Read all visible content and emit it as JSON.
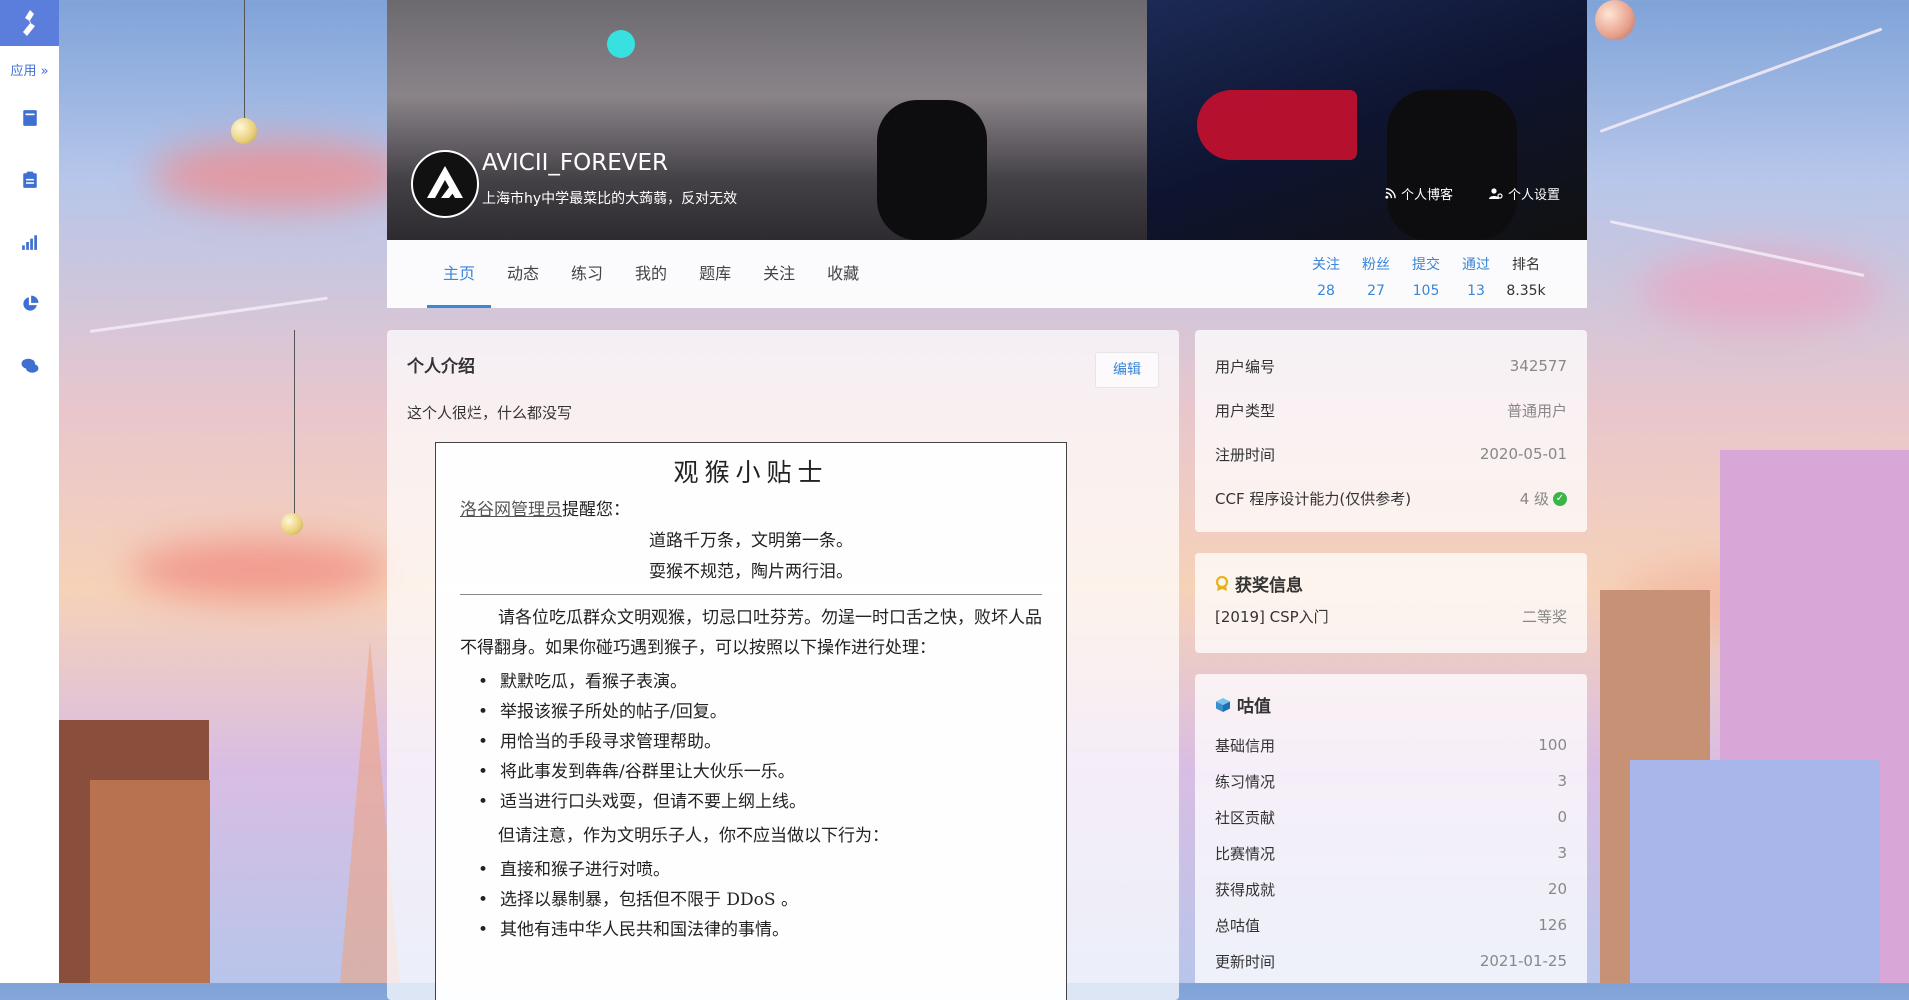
{
  "sidebar": {
    "apps_label": "应用",
    "items": [
      {
        "icon": "book-icon"
      },
      {
        "icon": "clipboard-icon"
      },
      {
        "icon": "signal-bars-icon"
      },
      {
        "icon": "pie-chart-icon"
      },
      {
        "icon": "chat-bubbles-icon"
      }
    ]
  },
  "profile": {
    "username": "AVICII_FOREVER",
    "slogan": "上海市hy中学最菜比的大蒟蒻，反对无效",
    "blog_link": "个人博客",
    "settings_link": "个人设置"
  },
  "nav": {
    "tabs": [
      "主页",
      "动态",
      "练习",
      "我的",
      "题库",
      "关注",
      "收藏"
    ],
    "active_tab": "主页"
  },
  "stats": [
    {
      "label": "关注",
      "value": "28"
    },
    {
      "label": "粉丝",
      "value": "27"
    },
    {
      "label": "提交",
      "value": "105"
    },
    {
      "label": "通过",
      "value": "13"
    },
    {
      "label": "排名",
      "value": "8.35k"
    }
  ],
  "intro": {
    "title": "个人介绍",
    "edit_label": "编辑",
    "text": "这个人很烂，什么都没写",
    "notice": {
      "title": "观猴小贴士",
      "reminder_link": "洛谷网管理员",
      "reminder_rest": "提醒您：",
      "couplet_1": "道路千万条，文明第一条。",
      "couplet_2": "耍猴不规范，陶片两行泪。",
      "paragraph_1": "请各位吃瓜群众文明观猴，切忌口吐芬芳。勿逞一时口舌之快，败坏人品不得翻身。如果你碰巧遇到猴子，可以按照以下操作进行处理：",
      "list_1": [
        "默默吃瓜，看猴子表演。",
        "举报该猴子所处的帖子/回复。",
        "用恰当的手段寻求管理帮助。",
        "将此事发到犇犇/谷群里让大伙乐一乐。",
        "适当进行口头戏耍，但请不要上纲上线。"
      ],
      "paragraph_2": "但请注意，作为文明乐子人，你不应当做以下行为：",
      "list_2": [
        "直接和猴子进行对喷。",
        "选择以暴制暴，包括但不限于 DDoS 。",
        "其他有违中华人民共和国法律的事情。"
      ]
    }
  },
  "user_info": {
    "rows": [
      {
        "label": "用户编号",
        "value": "342577"
      },
      {
        "label": "用户类型",
        "value": "普通用户"
      },
      {
        "label": "注册时间",
        "value": "2020-05-01"
      },
      {
        "label": "CCF 程序设计能力(仅供参考)",
        "value": "4 级"
      }
    ]
  },
  "awards": {
    "title": "获奖信息",
    "rows": [
      {
        "label": "[2019] CSP入门",
        "value": "二等奖"
      }
    ]
  },
  "guzhi": {
    "title": "咕值",
    "rows": [
      {
        "label": "基础信用",
        "value": "100"
      },
      {
        "label": "练习情况",
        "value": "3"
      },
      {
        "label": "社区贡献",
        "value": "0"
      },
      {
        "label": "比赛情况",
        "value": "3"
      },
      {
        "label": "获得成就",
        "value": "20"
      },
      {
        "label": "总咕值",
        "value": "126"
      },
      {
        "label": "更新时间",
        "value": "2021-01-25"
      }
    ]
  },
  "colors": {
    "accent": "#3a86d8",
    "sidebar_logo": "#5b7ddb",
    "success": "#3ab54a"
  }
}
